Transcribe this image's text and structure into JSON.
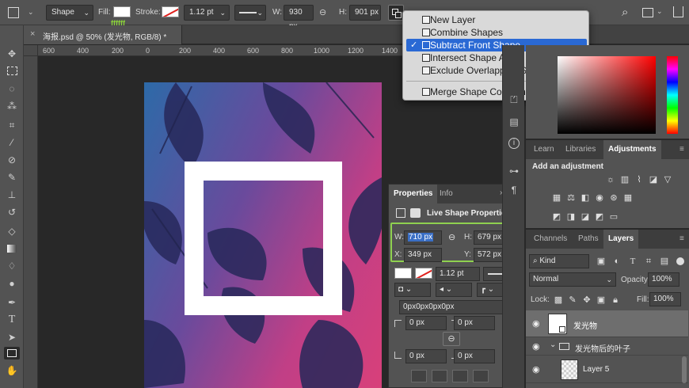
{
  "options_bar": {
    "mode_value": "Shape",
    "fill_label": "Fill:",
    "fill_color": "#ffffff",
    "fill_hex_tooltip": "ffffff",
    "stroke_label": "Stroke:",
    "stroke_width": "1.12 pt",
    "w_label": "W:",
    "w_value": "930 px",
    "h_label": "H:",
    "h_value": "901 px"
  },
  "document_tab": {
    "title": "海报.psd @ 50% (发光物, RGB/8) *"
  },
  "ruler": {
    "ticks": [
      "600",
      "400",
      "200",
      "0",
      "200",
      "400",
      "600",
      "800",
      "1000",
      "1200",
      "1400"
    ]
  },
  "path_ops_menu": {
    "items": [
      {
        "label": "New Layer",
        "selected": false
      },
      {
        "label": "Combine Shapes",
        "selected": false
      },
      {
        "label": "Subtract Front Shape",
        "selected": true
      },
      {
        "label": "Intersect Shape Areas",
        "selected": false
      },
      {
        "label": "Exclude Overlapping Shapes",
        "selected": false
      },
      {
        "label": "Merge Shape Components",
        "selected": false
      }
    ],
    "check_glyph": "✓"
  },
  "properties_panel": {
    "tab_properties": "Properties",
    "tab_info": "Info",
    "section_title": "Live Shape Properties",
    "w_label": "W:",
    "w_value": "710 px",
    "h_label": "H:",
    "h_value": "679 px",
    "x_label": "X:",
    "x_value": "349 px",
    "y_label": "Y:",
    "y_value": "572 px",
    "stroke_width": "1.12 pt",
    "corner_radii": "0px0px0px0px",
    "radius_tl": "0 px",
    "radius_tr": "0 px",
    "radius_bl": "0 px",
    "radius_br": "0 px"
  },
  "color_panel": {
    "accent": "#ff0000"
  },
  "adjustments_panel": {
    "tabs": [
      "Learn",
      "Libraries",
      "Adjustments"
    ],
    "active_tab": "Adjustments",
    "add_label": "Add an adjustment"
  },
  "layers_panel": {
    "tabs": [
      "Channels",
      "Paths",
      "Layers"
    ],
    "active_tab": "Layers",
    "filter_value": "Kind",
    "blend_mode": "Normal",
    "opacity_label": "Opacity:",
    "opacity_value": "100%",
    "lock_label": "Lock:",
    "fill_label": "Fill:",
    "fill_value": "100%",
    "layers": [
      {
        "name": "发光物",
        "kind": "shape",
        "selected": true
      },
      {
        "name": "发光物后的叶子",
        "kind": "group",
        "selected": false
      },
      {
        "name": "Layer 5",
        "kind": "pixel",
        "selected": false
      }
    ]
  }
}
